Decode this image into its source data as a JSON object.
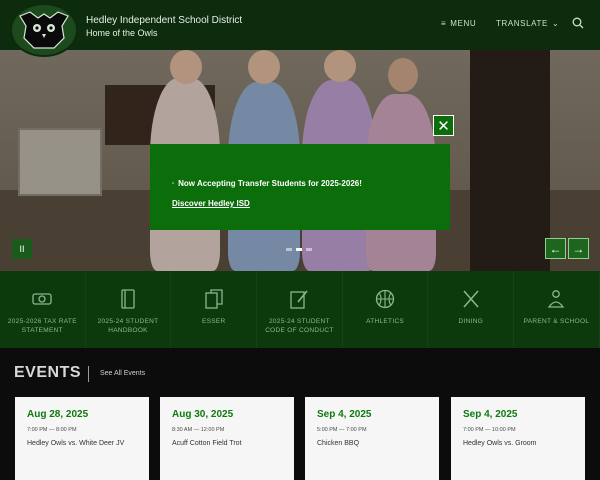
{
  "header": {
    "district_name": "Hedley Independent School District",
    "tagline": "Home of the Owls",
    "menu_label": "MENU",
    "translate_label": "TRANSLATE"
  },
  "hero": {
    "pause_label": "II",
    "prev_label": "←",
    "next_label": "→"
  },
  "modal": {
    "message": "Now Accepting Transfer Students for 2025-2026!",
    "link_label": "Discover Hedley ISD",
    "close_label": "✕"
  },
  "quicklinks": [
    {
      "label": "2025-2026 TAX RATE STATEMENT",
      "icon": "money-icon"
    },
    {
      "label": "2025-24 STUDENT HANDBOOK",
      "icon": "handbook-icon"
    },
    {
      "label": "ESSER",
      "icon": "documents-icon"
    },
    {
      "label": "2025-24 STUDENT CODE OF CONDUCT",
      "icon": "pencil-document-icon"
    },
    {
      "label": "ATHLETICS",
      "icon": "basketball-icon"
    },
    {
      "label": "DINING",
      "icon": "utensils-icon"
    },
    {
      "label": "PARENT & SCHOOL",
      "icon": "parent-icon"
    }
  ],
  "events": {
    "title": "EVENTS",
    "see_all_label": "See All Events",
    "items": [
      {
        "date": "Aug 28, 2025",
        "time": "7:00 PM — 8:00 PM",
        "name": "Hedley Owls vs. White Deer JV"
      },
      {
        "date": "Aug 30, 2025",
        "time": "8:30 AM — 12:00 PM",
        "name": "Acuff Cotton Field Trot"
      },
      {
        "date": "Sep 4, 2025",
        "time": "5:00 PM — 7:00 PM",
        "name": "Chicken BBQ"
      },
      {
        "date": "Sep 4, 2025",
        "time": "7:00 PM — 10:00 PM",
        "name": "Hedley Owls vs. Groom"
      }
    ]
  }
}
